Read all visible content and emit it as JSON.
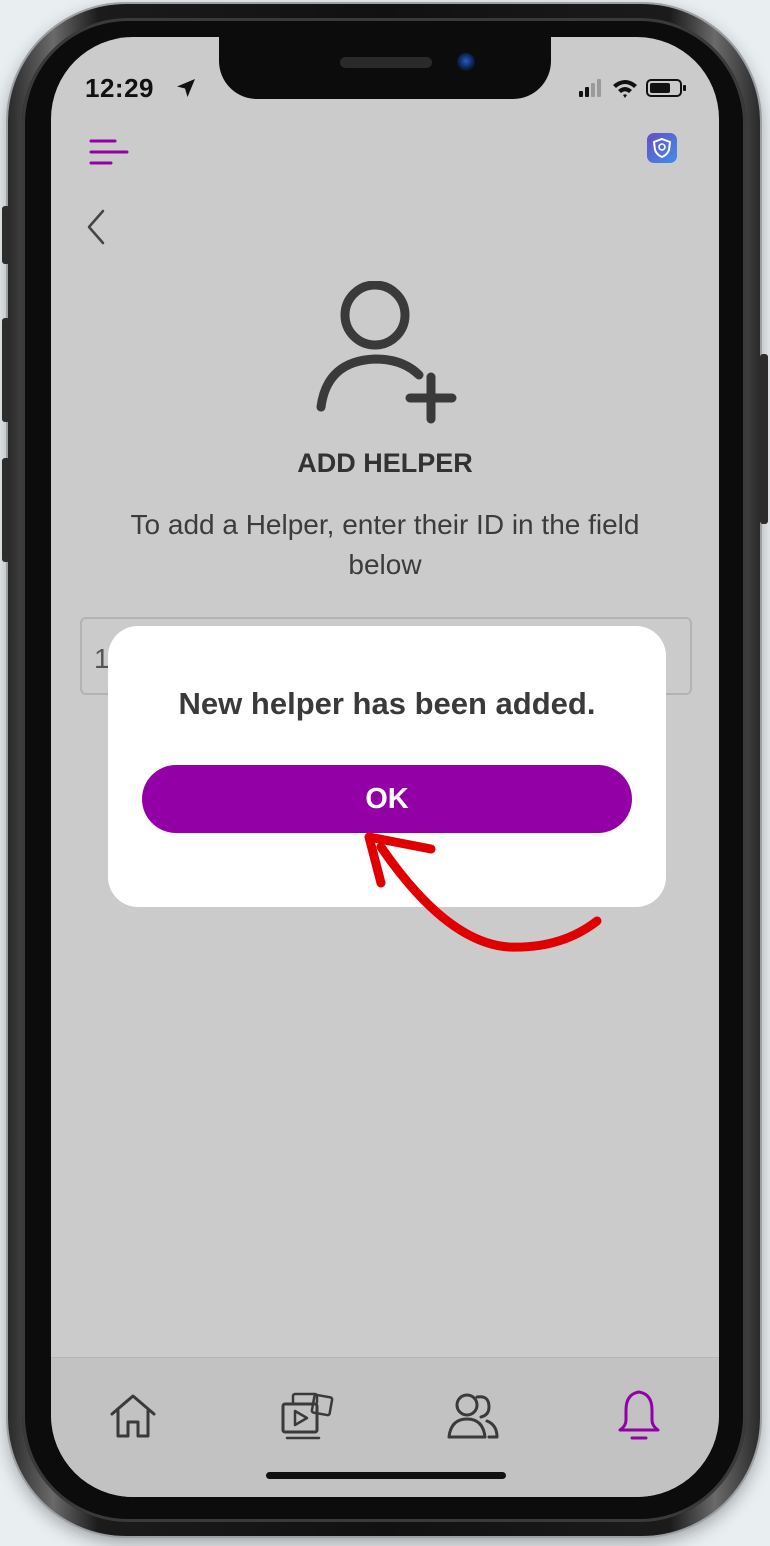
{
  "status_bar": {
    "time": "12:29"
  },
  "header": {
    "menu_icon": "menu-icon",
    "logo_icon": "app-logo-icon",
    "back_icon": "chevron-left-icon"
  },
  "page": {
    "icon": "add-person-icon",
    "title": "ADD HELPER",
    "instructions": "To add a Helper, enter their ID in the field below",
    "id_field_value": "1"
  },
  "dialog": {
    "message": "New helper has been added.",
    "ok_label": "OK"
  },
  "tab_bar": {
    "items": [
      {
        "name": "home",
        "icon": "home-icon",
        "active": false
      },
      {
        "name": "media",
        "icon": "media-gallery-icon",
        "active": false
      },
      {
        "name": "helpers",
        "icon": "users-icon",
        "active": false
      },
      {
        "name": "notifications",
        "icon": "bell-icon",
        "active": true
      }
    ]
  },
  "colors": {
    "accent": "#9200a6",
    "annotation": "#e00000",
    "screen_background": "#cbcbcb",
    "dialog_background": "#ffffff"
  }
}
